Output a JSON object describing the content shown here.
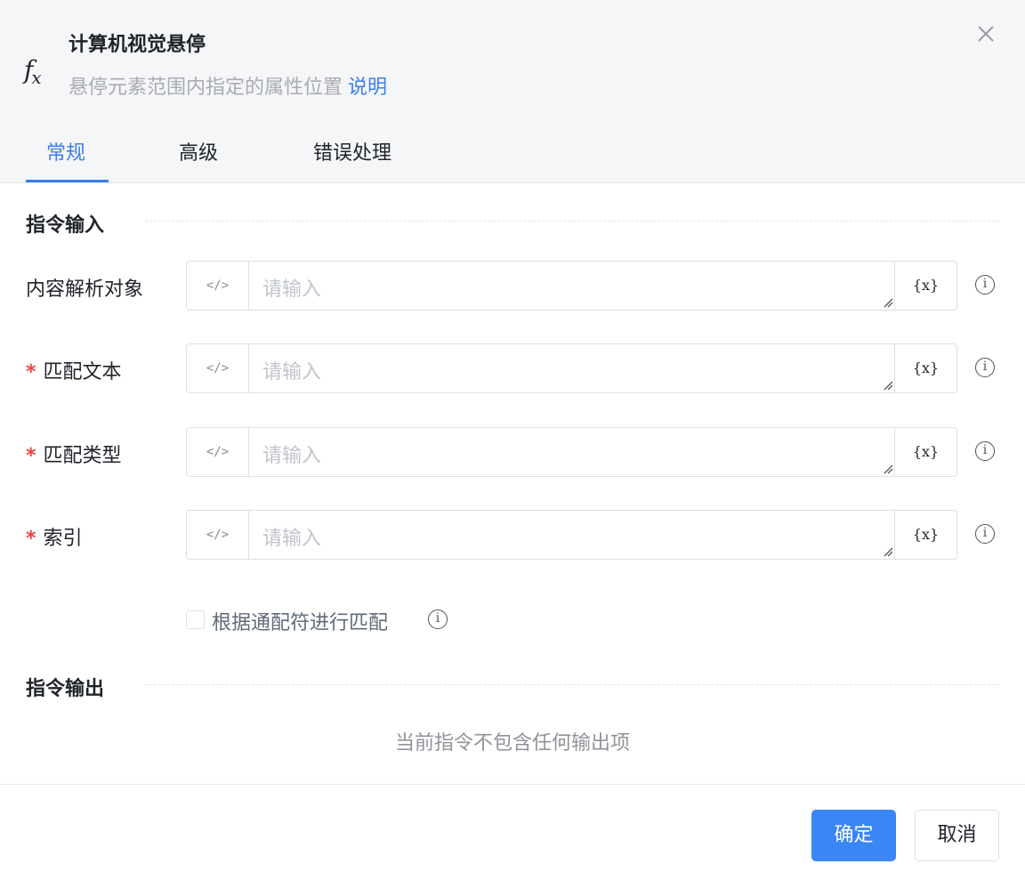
{
  "dialog": {
    "title": "计算机视觉悬停",
    "description": "悬停元素范围内指定的属性位置",
    "help_link": "说明",
    "icon": "fx-function-icon",
    "close_icon": "close-icon"
  },
  "tabs": [
    {
      "label": "常规",
      "active": true
    },
    {
      "label": "高级",
      "active": false
    },
    {
      "label": "错误处理",
      "active": false
    }
  ],
  "input_section": {
    "title": "指令输入",
    "fields": [
      {
        "label": "内容解析对象",
        "required": false,
        "placeholder": "请输入",
        "code_icon": "</>",
        "var_icon": "{x}"
      },
      {
        "label": "匹配文本",
        "required": true,
        "placeholder": "请输入",
        "code_icon": "</>",
        "var_icon": "{x}"
      },
      {
        "label": "匹配类型",
        "required": true,
        "placeholder": "请输入",
        "code_icon": "</>",
        "var_icon": "{x}"
      },
      {
        "label": "索引",
        "required": true,
        "placeholder": "请输入",
        "code_icon": "</>",
        "var_icon": "{x}"
      }
    ],
    "wildcard_checkbox": {
      "label": "根据通配符进行匹配",
      "checked": false
    }
  },
  "output_section": {
    "title": "指令输出",
    "empty_text": "当前指令不包含任何输出项"
  },
  "footer": {
    "confirm_label": "确定",
    "cancel_label": "取消"
  },
  "colors": {
    "accent": "#3a86f7",
    "required": "#f53f3f",
    "header_bg": "#f5f6f7"
  }
}
